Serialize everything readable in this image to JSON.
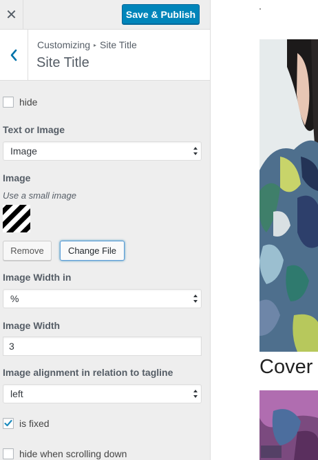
{
  "topbar": {
    "close_glyph": "✕",
    "publish_label": "Save & Publish"
  },
  "section": {
    "breadcrumb_root": "Customizing",
    "breadcrumb_current": "Site Title",
    "title": "Site Title"
  },
  "controls": {
    "hide": {
      "label": "hide",
      "checked": false
    },
    "text_or_image": {
      "heading": "Text or Image",
      "value": "Image"
    },
    "image": {
      "heading": "Image",
      "description": "Use a small image",
      "remove_label": "Remove",
      "change_label": "Change File"
    },
    "image_width_in": {
      "heading": "Image Width in",
      "value": "%"
    },
    "image_width": {
      "heading": "Image Width",
      "value": "3"
    },
    "alignment": {
      "heading": "Image alignment in relation to tagline",
      "value": "left"
    },
    "is_fixed": {
      "label": "is fixed",
      "checked": true
    },
    "hide_scrolling": {
      "label": "hide when scrolling down",
      "checked": false
    }
  },
  "preview": {
    "heading_text": "Cover"
  },
  "colors": {
    "accent": "#0085ba",
    "panel_bg": "#eeeeee",
    "check": "#1e8cbe"
  },
  "icons": {
    "close": "close-icon",
    "back": "chevron-left-icon",
    "select_arrows": "select-arrows-icon",
    "checkmark": "checkmark-icon"
  }
}
